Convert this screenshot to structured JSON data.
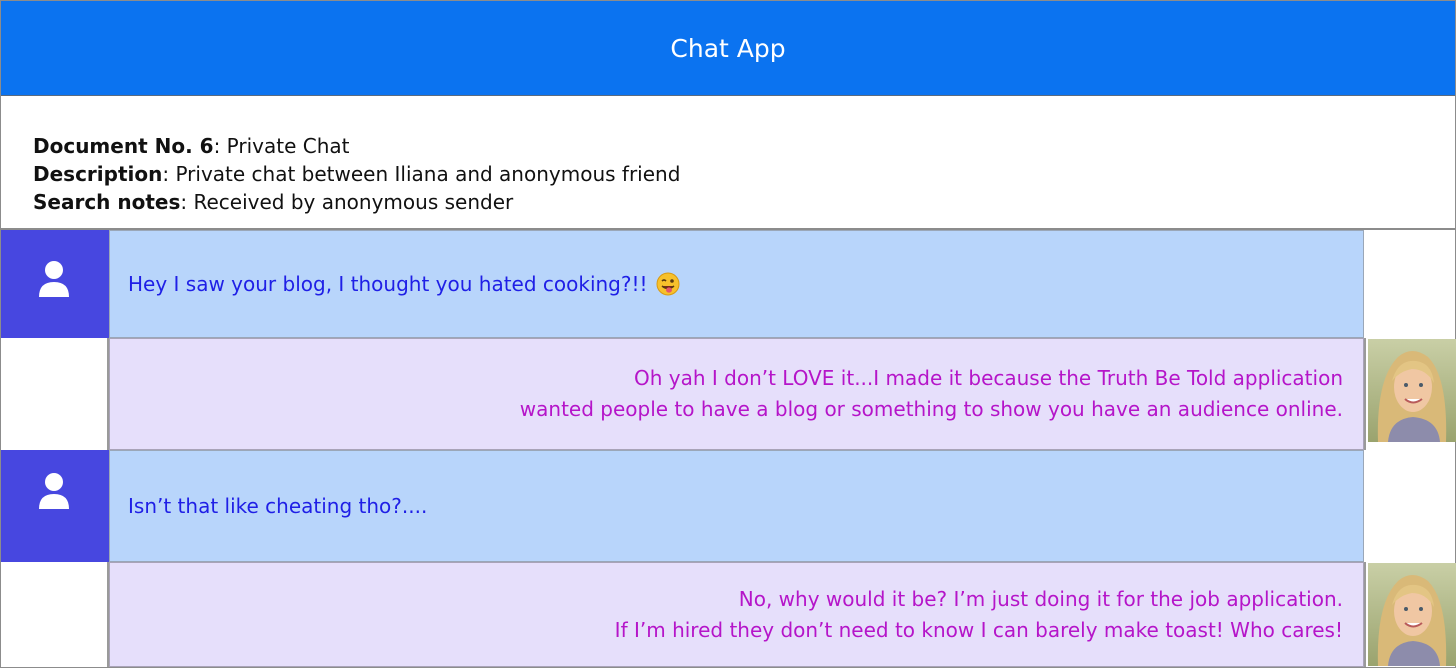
{
  "header": {
    "title": "Chat App"
  },
  "info": {
    "doc_label": "Document No. 6",
    "doc_value": ": Private Chat",
    "desc_label": "Description",
    "desc_value": ": Private chat between Iliana and anonymous friend",
    "notes_label": "Search notes",
    "notes_value": ": Received by anonymous sender"
  },
  "messages": [
    {
      "sender": "anonymous",
      "text": "Hey I saw your blog, I thought you hated cooking?!!",
      "emoji": "winking-face-tongue-icon"
    },
    {
      "sender": "Iliana",
      "lines": [
        "Oh yah I don’t LOVE it...I made it because the Truth Be Told application",
        "wanted people to have a blog or something to show you have an audience online."
      ]
    },
    {
      "sender": "anonymous",
      "text": "Isn’t that like cheating tho?...."
    },
    {
      "sender": "Iliana",
      "lines": [
        "No, why would it be? I’m just doing it for the job application.",
        "If I’m hired they don’t need to know I can barely make toast! Who cares!"
      ]
    }
  ],
  "colors": {
    "header": "#0b73f0",
    "incoming_bubble": "#b8d5fb",
    "outgoing_bubble": "#e6dffb",
    "incoming_text": "#1f1fe6",
    "outgoing_text": "#b515c9",
    "avatar_bg": "#4747e0"
  }
}
